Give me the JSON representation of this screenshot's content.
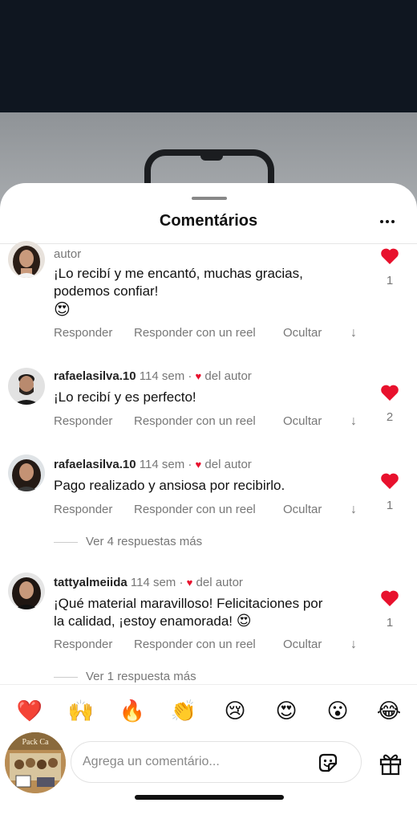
{
  "sheet": {
    "title": "Comentários"
  },
  "comments": [
    {
      "head": "autor",
      "text_line1": "¡Lo recibí y me encantó, muchas gracias,",
      "text_line2": "podemos confiar!",
      "likes": "1"
    },
    {
      "username": "rafaelasilva.10",
      "time": "114 sem",
      "author_badge": "del autor",
      "text": "¡Lo recibí y es perfecto!",
      "likes": "2"
    },
    {
      "username": "rafaelasilva.10",
      "time": "114 sem",
      "author_badge": "del autor",
      "text": "Pago realizado y ansiosa por recibirlo.",
      "likes": "1",
      "more_replies": "Ver 4 respuestas más"
    },
    {
      "username": "tattyalmeiida",
      "time": "114 sem",
      "author_badge": "del autor",
      "text_line1": "¡Qué material maravilloso! Felicitaciones por",
      "text_line2": "la calidad, ¡estoy enamorada!",
      "likes": "1",
      "more_replies": "Ver 1 respuesta más"
    }
  ],
  "actions": {
    "reply": "Responder",
    "reply_reel": "Responder con un reel",
    "hide": "Ocultar"
  },
  "separator": "·",
  "reactions": [
    "❤️",
    "🙌",
    "🔥",
    "👏",
    "😢",
    "😍",
    "😮",
    "😂"
  ],
  "composer": {
    "placeholder": "Agrega un comentário...",
    "avatar_text": "Pack Ca"
  },
  "colors": {
    "like": "#e8112d",
    "muted": "#777777"
  }
}
